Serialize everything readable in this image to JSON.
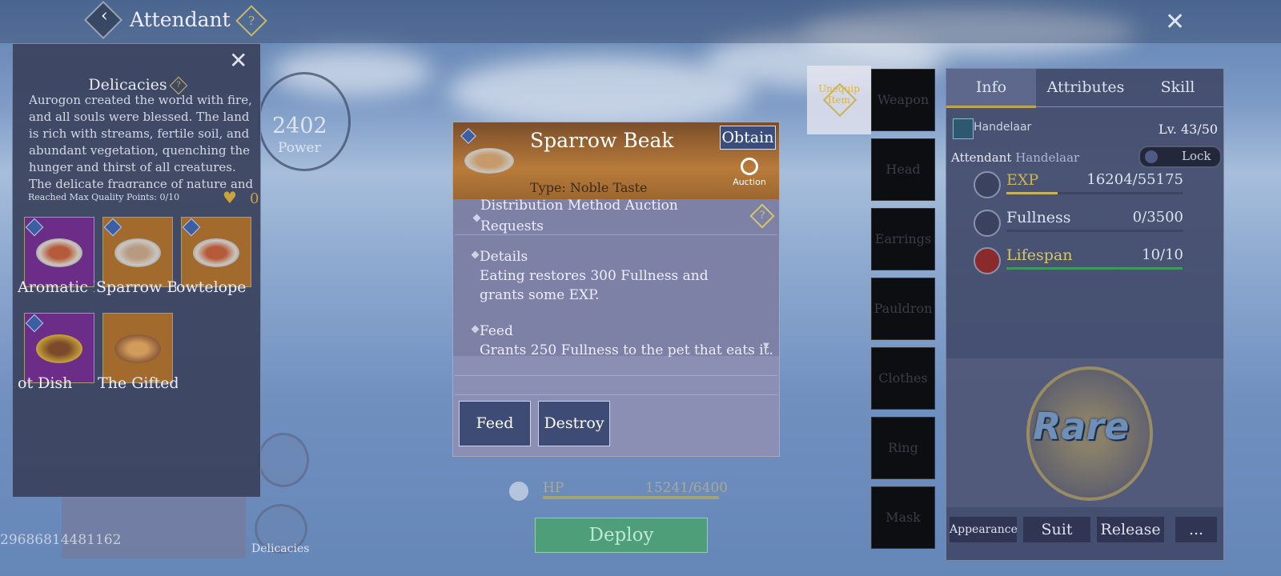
{
  "header": {
    "title": "Attendant"
  },
  "left_panel": {
    "title": "Delicacies",
    "description": "Aurogon created the world with fire, and all souls were blessed. The land is rich with streams, fertile soil, and abundant vegetation, quenching the hunger and thirst of all creatures. The delicate fragrance of nature and",
    "reached": "Reached Max Quality Points: 0/10",
    "points": "0",
    "items": [
      {
        "name": "Aromatic L"
      },
      {
        "name": "Sparrow Be"
      },
      {
        "name": "owtelope"
      },
      {
        "name": "ot Dish"
      },
      {
        "name": "The Gifted"
      }
    ]
  },
  "power": {
    "value": "2402",
    "label": "Power"
  },
  "delicacies_btn": {
    "label": "Delicacies"
  },
  "uid": "29686814481162",
  "detail": {
    "name": "Sparrow Beak",
    "obtain": "Obtain",
    "type": "Type: Noble Taste",
    "auction": "Auction",
    "distribution": "Distribution Method    Auction",
    "requests": "Requests",
    "details_title": "Details",
    "details_text": "Eating restores 300 Fullness and grants some EXP.",
    "feed_title": "Feed",
    "feed_text": "Grants 250 Fullness to the pet that eats it.",
    "feed_btn": "Feed",
    "destroy_btn": "Destroy"
  },
  "hp": {
    "label": "HP",
    "value": "15241/6400",
    "fill": 1.0
  },
  "deploy": "Deploy",
  "equipment": {
    "unequip": "Unequip Item",
    "slots": [
      "Weapon",
      "Head",
      "Earrings",
      "Pauldron",
      "Clothes",
      "Ring",
      "Mask"
    ]
  },
  "right_panel": {
    "tabs": [
      "Info",
      "Attributes",
      "Skill"
    ],
    "name": "Handelaar",
    "level": "Lv. 43/50",
    "attendant_label": "Attendant",
    "attendant_name": "Handelaar",
    "lock": "Lock",
    "stats": [
      {
        "label": "EXP",
        "value": "16204/55175",
        "fill": 0.29,
        "color": "#c9b35a",
        "label_color": "#c9b35a"
      },
      {
        "label": "Fullness",
        "value": "0/3500",
        "fill": 0.0,
        "color": "#c9b35a",
        "label_color": "#dde2ee"
      },
      {
        "label": "Lifespan",
        "value": "10/10",
        "fill": 1.0,
        "color": "#3d9a5c",
        "label_color": "#d6c66c"
      }
    ],
    "rarity": "Rare",
    "buttons": [
      "Appearance",
      "Suit",
      "Release",
      "..."
    ]
  }
}
